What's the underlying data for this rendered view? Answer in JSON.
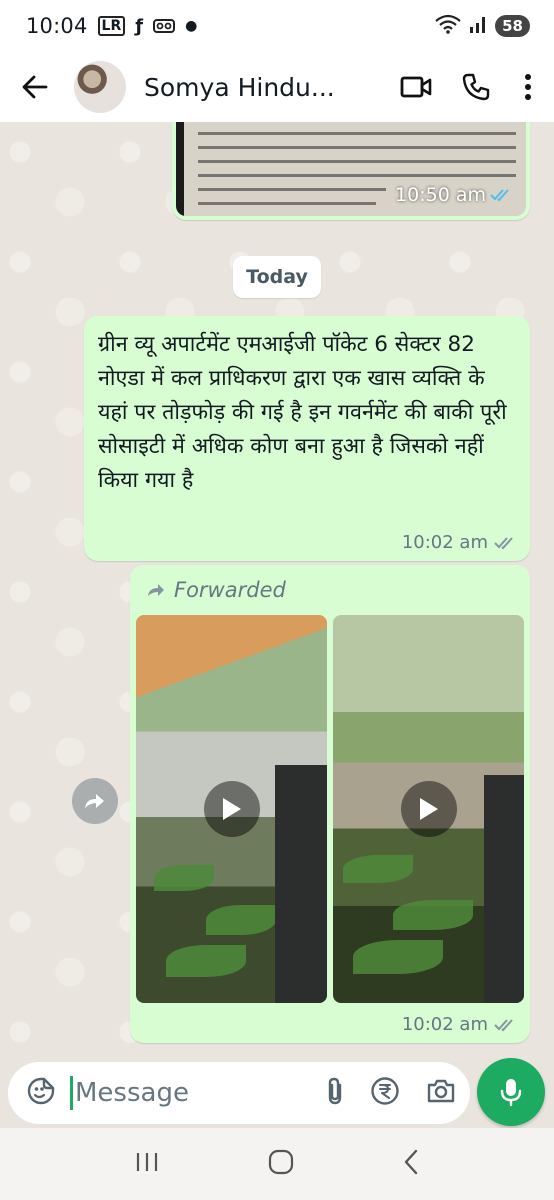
{
  "status_bar": {
    "time": "10:04",
    "icons": [
      "lr-app-icon",
      "facebook-icon",
      "voicemail-icon",
      "dot-icon"
    ],
    "lr_label": "LR",
    "battery": "58"
  },
  "header": {
    "contact_name": "Somya Hindu...",
    "actions": [
      "video-call-icon",
      "voice-call-icon",
      "more-options-icon"
    ]
  },
  "chat": {
    "image_message": {
      "time": "10:50 am"
    },
    "date_chip": "Today",
    "text_message": {
      "text": "ग्रीन व्यू अपार्टमेंट एमआईजी पॉकेट 6 सेक्टर 82 नोएडा में कल प्राधिकरण द्वारा एक खास व्यक्ति के यहां पर तोड़फोड़ की गई है इन गवर्नमेंट की बाकी पूरी सोसाइटी में अधिक कोण बना हुआ है जिसको नहीं किया गया है",
      "time": "10:02 am"
    },
    "forwarded_message": {
      "label": "Forwarded",
      "time": "10:02 am",
      "videos": 2
    }
  },
  "composer": {
    "placeholder": "Message",
    "actions": [
      "attach-icon",
      "rupee-payment-icon",
      "camera-icon"
    ]
  },
  "nav": [
    "recents-icon",
    "home-icon",
    "back-nav-icon"
  ],
  "colors": {
    "bubble_out": "#d9fdd3",
    "accent": "#1daa61",
    "meta_text": "#667781",
    "chat_bg": "#e9e5de"
  }
}
